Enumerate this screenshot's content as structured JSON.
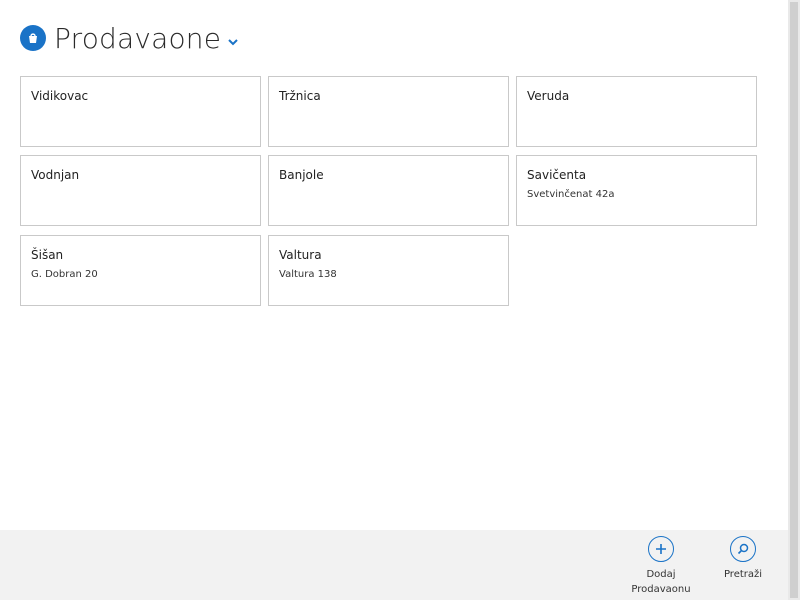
{
  "header": {
    "title": "Prodavaone"
  },
  "tiles": [
    {
      "name": "Vidikovac",
      "address": ""
    },
    {
      "name": "Tržnica",
      "address": ""
    },
    {
      "name": "Veruda",
      "address": ""
    },
    {
      "name": "Vodnjan",
      "address": ""
    },
    {
      "name": "Banjole",
      "address": ""
    },
    {
      "name": "Savičenta",
      "address": "Svetvinčenat 42a"
    },
    {
      "name": "Šišan",
      "address": "G. Dobran 20"
    },
    {
      "name": "Valtura",
      "address": "Valtura 138"
    }
  ],
  "appbar": {
    "add_line1": "Dodaj",
    "add_line2": "Prodavaonu",
    "search_label": "Pretraži"
  },
  "colors": {
    "accent": "#1a73c7",
    "tile_border": "#c9c9c9",
    "appbar_bg": "#f2f2f2"
  },
  "icons": {
    "app": "shopping-bag-icon",
    "chevron": "chevron-down-icon",
    "add": "plus-circle-icon",
    "search": "search-circle-icon"
  }
}
